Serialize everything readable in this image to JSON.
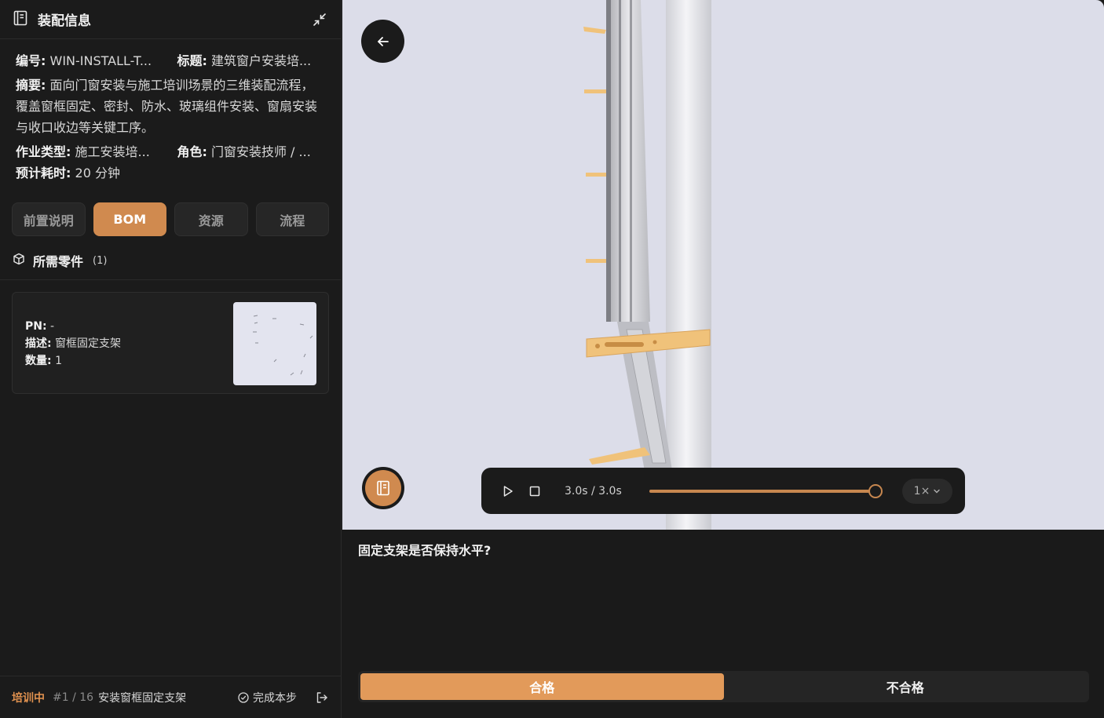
{
  "panel": {
    "title": "装配信息",
    "meta": {
      "id_label": "编号",
      "id_value": "WIN-INSTALL-T...",
      "title_label": "标题",
      "title_value": "建筑窗户安装培...",
      "summary_label": "摘要",
      "summary_value": "面向门窗安装与施工培训场景的三维装配流程，覆盖窗框固定、密封、防水、玻璃组件安装、窗扇安装与收口收边等关键工序。",
      "type_label": "作业类型",
      "type_value": "施工安装培...",
      "role_label": "角色",
      "role_value": "门窗安装技师 / ...",
      "time_label": "预计耗时",
      "time_value": "20 分钟"
    },
    "tabs": [
      {
        "label": "前置说明",
        "active": false
      },
      {
        "label": "BOM",
        "active": true
      },
      {
        "label": "资源",
        "active": false
      },
      {
        "label": "流程",
        "active": false
      }
    ],
    "parts": {
      "heading": "所需零件",
      "count": "(1)",
      "items": [
        {
          "pn_label": "PN",
          "pn_value": "-",
          "desc_label": "描述",
          "desc_value": "窗框固定支架",
          "qty_label": "数量",
          "qty_value": "1"
        }
      ]
    },
    "footer": {
      "status": "培训中",
      "step_index": "#1 / 16",
      "step_name": "安装窗框固定支架",
      "complete_label": "完成本步"
    }
  },
  "player": {
    "time": "3.0s / 3.0s",
    "progress": 1.0,
    "speed": "1×"
  },
  "question": {
    "text": "固定支架是否保持水平?",
    "options": [
      {
        "label": "合格",
        "selected": true
      },
      {
        "label": "不合格",
        "selected": false
      }
    ]
  },
  "colors": {
    "accent": "#d08a4f",
    "accent_light": "#e29a5a",
    "panel_bg": "#1b1b1b",
    "viewport_bg": "#dcdde9",
    "bracket": "#f0c27a"
  }
}
